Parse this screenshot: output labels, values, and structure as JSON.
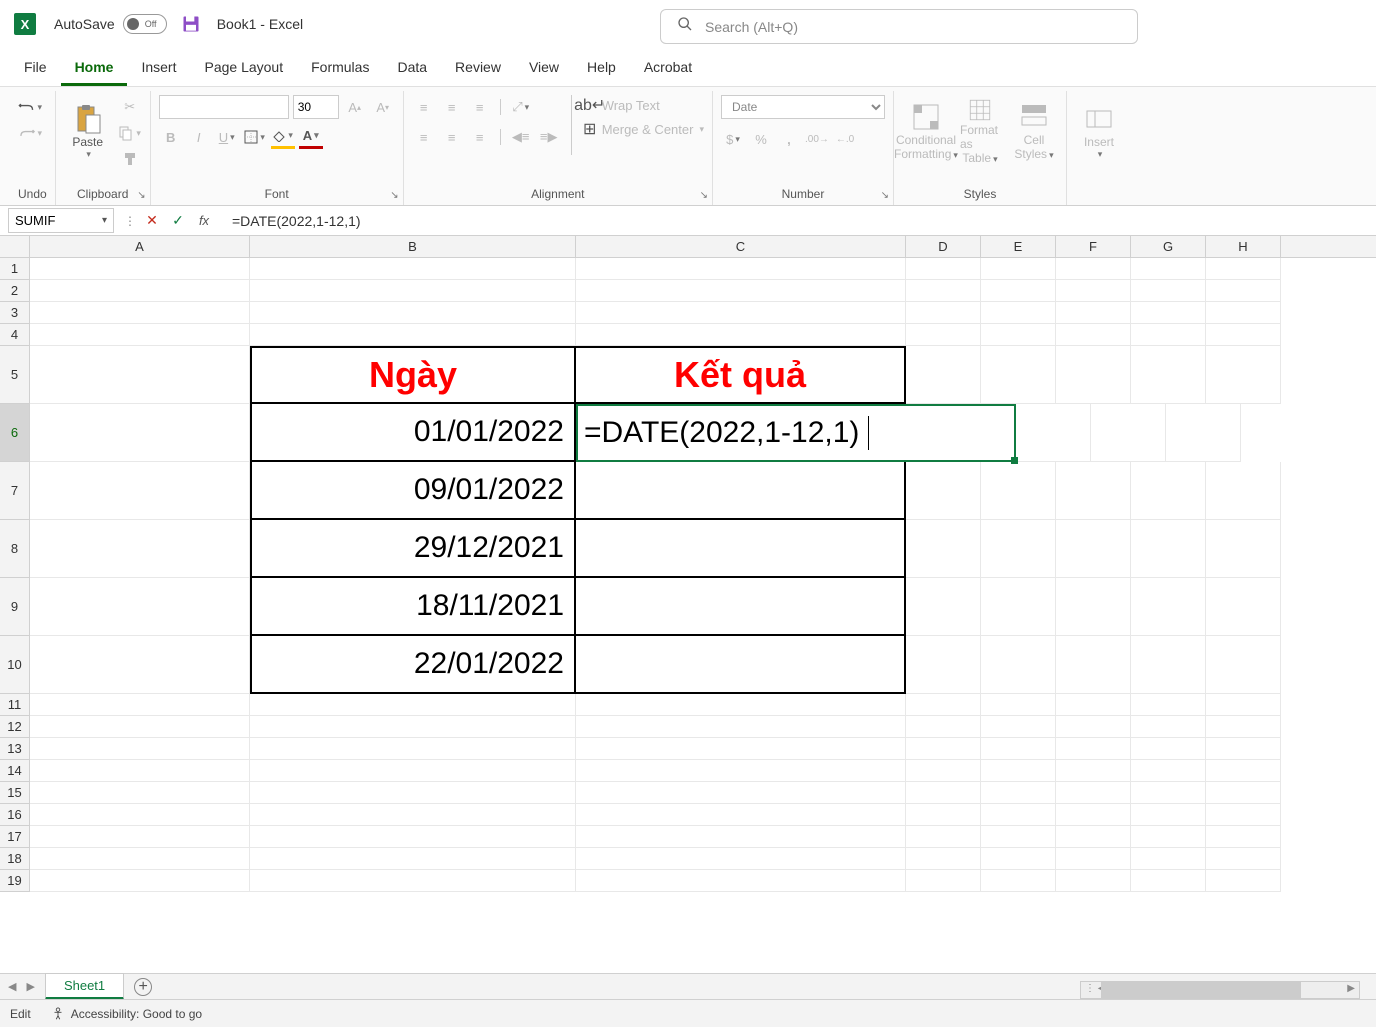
{
  "titlebar": {
    "autosave": "AutoSave",
    "toggle_state": "Off",
    "doc_title": "Book1  -  Excel",
    "search_placeholder": "Search (Alt+Q)"
  },
  "tabs": {
    "file": "File",
    "home": "Home",
    "insert": "Insert",
    "page_layout": "Page Layout",
    "formulas": "Formulas",
    "data": "Data",
    "review": "Review",
    "view": "View",
    "help": "Help",
    "acrobat": "Acrobat"
  },
  "ribbon": {
    "undo": "Undo",
    "clipboard": "Clipboard",
    "paste": "Paste",
    "font": "Font",
    "font_name": "",
    "font_size": "30",
    "alignment": "Alignment",
    "wrap_text": "Wrap Text",
    "merge_center": "Merge & Center",
    "number": "Number",
    "number_format": "Date",
    "styles": "Styles",
    "cond_fmt1": "Conditional",
    "cond_fmt2": "Formatting",
    "fmt_as_table1": "Format as",
    "fmt_as_table2": "Table",
    "cell_styles1": "Cell",
    "cell_styles2": "Styles",
    "insert_btn": "Insert"
  },
  "formula_bar": {
    "name_box": "SUMIF",
    "formula": "=DATE(2022,1-12,1)"
  },
  "columns": [
    "A",
    "B",
    "C",
    "D",
    "E",
    "F",
    "G",
    "H"
  ],
  "row_numbers": [
    "1",
    "2",
    "3",
    "4",
    "5",
    "6",
    "7",
    "8",
    "9",
    "10",
    "11",
    "12",
    "13",
    "14",
    "15",
    "16",
    "17",
    "18",
    "19"
  ],
  "sheet": {
    "header_b5": "Ngày",
    "header_c5": "Kết quả",
    "b6": "01/01/2022",
    "b7": "09/01/2022",
    "b8": "29/12/2021",
    "b9": "18/11/2021",
    "b10": "22/01/2022",
    "c6_editing": "=DATE(2022,1-12,1)"
  },
  "sheet_tabs": {
    "sheet1": "Sheet1"
  },
  "status": {
    "mode": "Edit",
    "accessibility": "Accessibility: Good to go"
  }
}
